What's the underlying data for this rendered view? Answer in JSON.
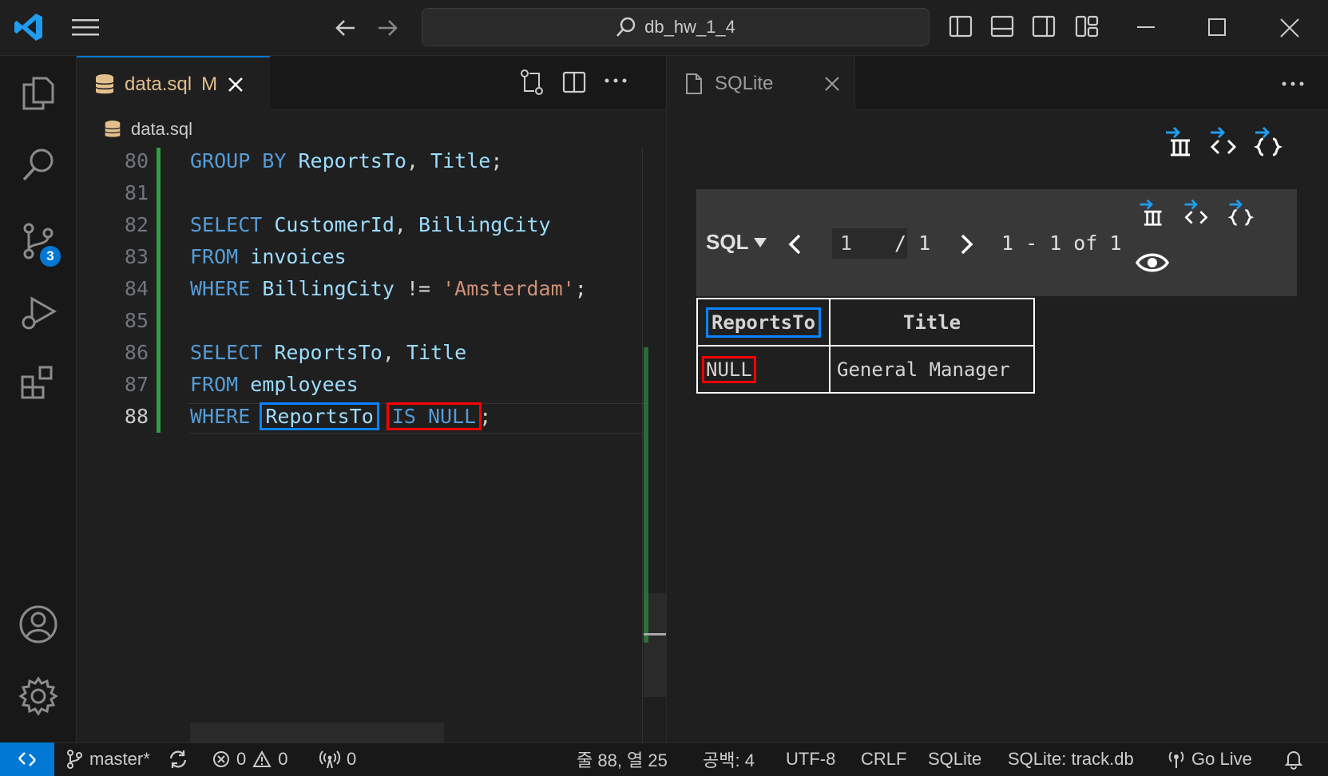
{
  "titlebar": {
    "search_text": "db_hw_1_4"
  },
  "activity_bar": {
    "scm_badge": "3"
  },
  "editor_group1": {
    "tab": {
      "filename": "data.sql",
      "status": "M"
    },
    "breadcrumb": "data.sql",
    "lines": [
      {
        "num": "80",
        "tokens": [
          [
            "kw",
            "GROUP BY "
          ],
          [
            "id",
            "ReportsTo"
          ],
          [
            "p",
            ", "
          ],
          [
            "id",
            "Title"
          ],
          [
            "p",
            ";"
          ]
        ]
      },
      {
        "num": "81",
        "tokens": []
      },
      {
        "num": "82",
        "tokens": [
          [
            "kw",
            "SELECT "
          ],
          [
            "id",
            "CustomerId"
          ],
          [
            "p",
            ", "
          ],
          [
            "id",
            "BillingCity"
          ]
        ]
      },
      {
        "num": "83",
        "tokens": [
          [
            "kw",
            "FROM "
          ],
          [
            "id",
            "invoices"
          ]
        ]
      },
      {
        "num": "84",
        "tokens": [
          [
            "kw",
            "WHERE "
          ],
          [
            "id",
            "BillingCity"
          ],
          [
            "p",
            " != "
          ],
          [
            "str",
            "'Amsterdam'"
          ],
          [
            "p",
            ";"
          ]
        ]
      },
      {
        "num": "85",
        "tokens": []
      },
      {
        "num": "86",
        "tokens": [
          [
            "kw",
            "SELECT "
          ],
          [
            "id",
            "ReportsTo"
          ],
          [
            "p",
            ", "
          ],
          [
            "id",
            "Title"
          ]
        ]
      },
      {
        "num": "87",
        "tokens": [
          [
            "kw",
            "FROM "
          ],
          [
            "id",
            "employees"
          ]
        ]
      },
      {
        "num": "88",
        "tokens": [
          [
            "kw",
            "WHERE "
          ],
          [
            "idb",
            "ReportsTo"
          ],
          [
            "p",
            " "
          ],
          [
            "kwr",
            "IS NULL"
          ],
          [
            "p",
            ";"
          ]
        ]
      }
    ]
  },
  "editor_group2": {
    "tab": {
      "title": "SQLite"
    },
    "toolbar": {
      "mode_label": "SQL",
      "page_value": "1",
      "page_total": "/ 1",
      "range_text": "1 - 1 of 1"
    },
    "result": {
      "columns": [
        "ReportsTo",
        "Title"
      ],
      "rows": [
        [
          "NULL",
          "General Manager"
        ]
      ]
    }
  },
  "statusbar": {
    "branch": "master*",
    "errors": "0",
    "warnings": "0",
    "ports": "0",
    "position": "줄 88, 열 25",
    "spaces": "공백: 4",
    "encoding": "UTF-8",
    "eol": "CRLF",
    "language": "SQLite",
    "db": "SQLite: track.db",
    "golive": "Go Live"
  },
  "colors": {
    "accent": "#0078d4",
    "highlight_blue": "#0a84ff",
    "highlight_red": "#ff0000"
  }
}
